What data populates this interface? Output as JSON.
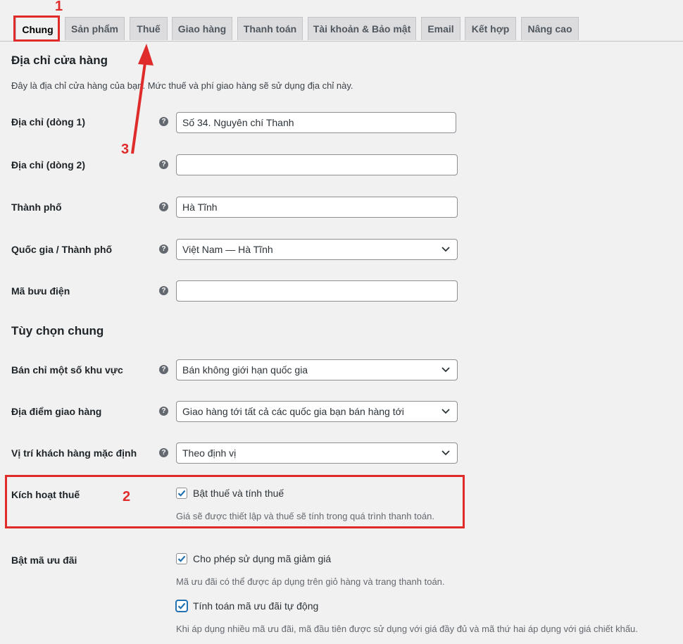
{
  "tabs": [
    "Chung",
    "Sản phẩm",
    "Thuế",
    "Giao hàng",
    "Thanh toán",
    "Tài khoản & Bảo mật",
    "Email",
    "Kết hợp",
    "Nâng cao"
  ],
  "store_address": {
    "heading": "Địa chỉ cửa hàng",
    "description": "Đây là địa chỉ cửa hàng của bạn. Mức thuế và phí giao hàng sẽ sử dụng địa chỉ này.",
    "address1": {
      "label": "Địa chỉ (dòng 1)",
      "value": "Số 34. Nguyên chí Thanh"
    },
    "address2": {
      "label": "Địa chỉ (dòng 2)",
      "value": ""
    },
    "city": {
      "label": "Thành phố",
      "value": "Hà Tĩnh"
    },
    "country": {
      "label": "Quốc gia / Thành phố",
      "value": "Việt Nam — Hà Tĩnh"
    },
    "postcode": {
      "label": "Mã bưu điện",
      "value": ""
    }
  },
  "general_options": {
    "heading": "Tùy chọn chung",
    "selling_location": {
      "label": "Bán chỉ một số khu vực",
      "value": "Bán không giới hạn quốc gia"
    },
    "shipping_location": {
      "label": "Địa điểm giao hàng",
      "value": "Giao hàng tới tất cả các quốc gia bạn bán hàng tới"
    },
    "default_customer": {
      "label": "Vị trí khách hàng mặc định",
      "value": "Theo định vị"
    },
    "enable_taxes": {
      "label": "Kích hoạt thuế",
      "checkbox_label": "Bật thuế và tính thuế",
      "checked": true,
      "note": "Giá sẽ được thiết lập và thuế sẽ tính trong quá trình thanh toán."
    },
    "coupons": {
      "label": "Bật mã ưu đãi",
      "enable_label": "Cho phép sử dụng mã giảm giá",
      "enable_checked": true,
      "enable_note": "Mã ưu đãi có thể được áp dụng trên giỏ hàng và trang thanh toán.",
      "sequential_label": "Tính toán mã ưu đãi tự động",
      "sequential_checked": true,
      "sequential_note": "Khi áp dụng nhiều mã ưu đãi, mã đầu tiên được sử dụng với giá đầy đủ và mã thứ hai áp dụng với giá chiết khấu."
    }
  },
  "help_glyph": "?",
  "annotations": {
    "one": "1",
    "two": "2",
    "three": "3",
    "color": "#e02b2b"
  }
}
